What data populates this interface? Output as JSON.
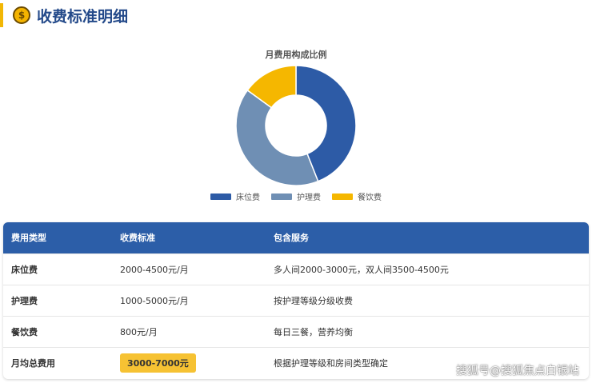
{
  "header": {
    "icon": "money-bag-icon",
    "title": "收费标准明细"
  },
  "chart_data": {
    "type": "pie",
    "title": "月费用构成比例",
    "categories": [
      "床位费",
      "护理费",
      "餐饮费"
    ],
    "values": [
      44,
      41,
      15
    ],
    "colors": [
      "#2d5ba6",
      "#6f8fb4",
      "#f5b700"
    ],
    "legend": "bottom"
  },
  "table": {
    "headers": [
      "费用类型",
      "收费标准",
      "包含服务"
    ],
    "rows": [
      {
        "type": "床位费",
        "price": "2000-4500元/月",
        "service": "多人间2000-3000元，双人间3500-4500元"
      },
      {
        "type": "护理费",
        "price": "1000-5000元/月",
        "service": "按护理等级分级收费"
      },
      {
        "type": "餐饮费",
        "price": "800元/月",
        "service": "每日三餐，营养均衡"
      },
      {
        "type": "月均总费用",
        "price": "3000-7000元",
        "service": "根据护理等级和房间类型确定"
      }
    ]
  },
  "watermark": "搜狐号@搜狐焦点白银站"
}
